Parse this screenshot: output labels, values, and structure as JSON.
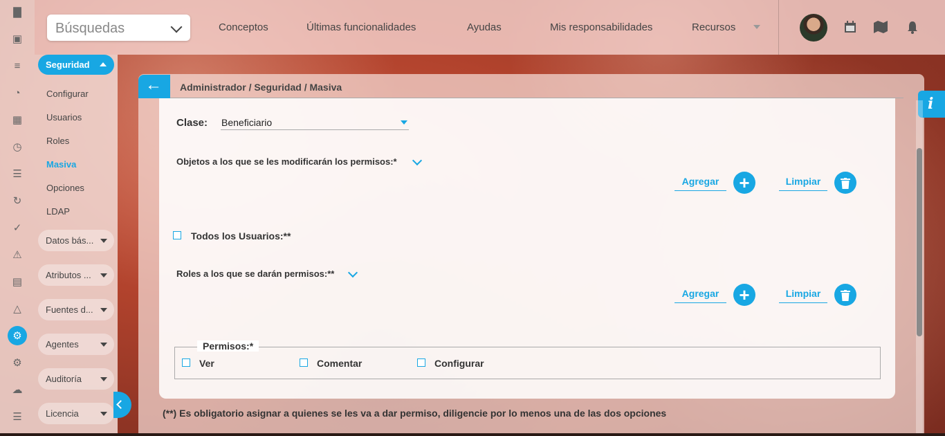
{
  "header": {
    "search_label": "Búsquedas",
    "nav": [
      "Conceptos",
      "Últimas funcionalidades",
      "Ayudas",
      "Mis responsabilidades",
      "Recursos"
    ]
  },
  "rail_icons": [
    "bar-chart-icon",
    "presentation-icon",
    "gantt-icon",
    "pie-icon",
    "map-icon",
    "clock-icon",
    "document-icon",
    "cycle-icon",
    "check-icon",
    "warning-icon",
    "calendar-icon",
    "network-icon",
    "gear-icon",
    "cogs-icon",
    "cloud-icon",
    "list-icon"
  ],
  "module": {
    "title": "Seguridad",
    "items": [
      "Configurar",
      "Usuarios",
      "Roles",
      "Masiva",
      "Opciones",
      "LDAP"
    ],
    "active": "Masiva",
    "groups": [
      "Datos bás...",
      "Atributos ...",
      "Fuentes d...",
      "Agentes",
      "Auditoría",
      "Licencia"
    ]
  },
  "breadcrumb": "Administrador / Seguridad / Masiva",
  "form": {
    "clase_label": "Clase:",
    "clase_value": "Beneficiario",
    "objetos_label": "Objetos a los que se les modificarán los permisos:*",
    "agregar": "Agregar",
    "limpiar": "Limpiar",
    "todos_usuarios": "Todos los Usuarios:**",
    "roles_label": "Roles a los que se darán permisos:**",
    "permisos_legend": "Permisos:*",
    "permisos": [
      "Ver",
      "Comentar",
      "Configurar"
    ]
  },
  "note": "(**) Es obligatorio asignar a quienes se les va a dar permiso, diligencie por lo menos una de las dos opciones",
  "info_label": "i",
  "colors": {
    "accent": "#18a7e3"
  }
}
